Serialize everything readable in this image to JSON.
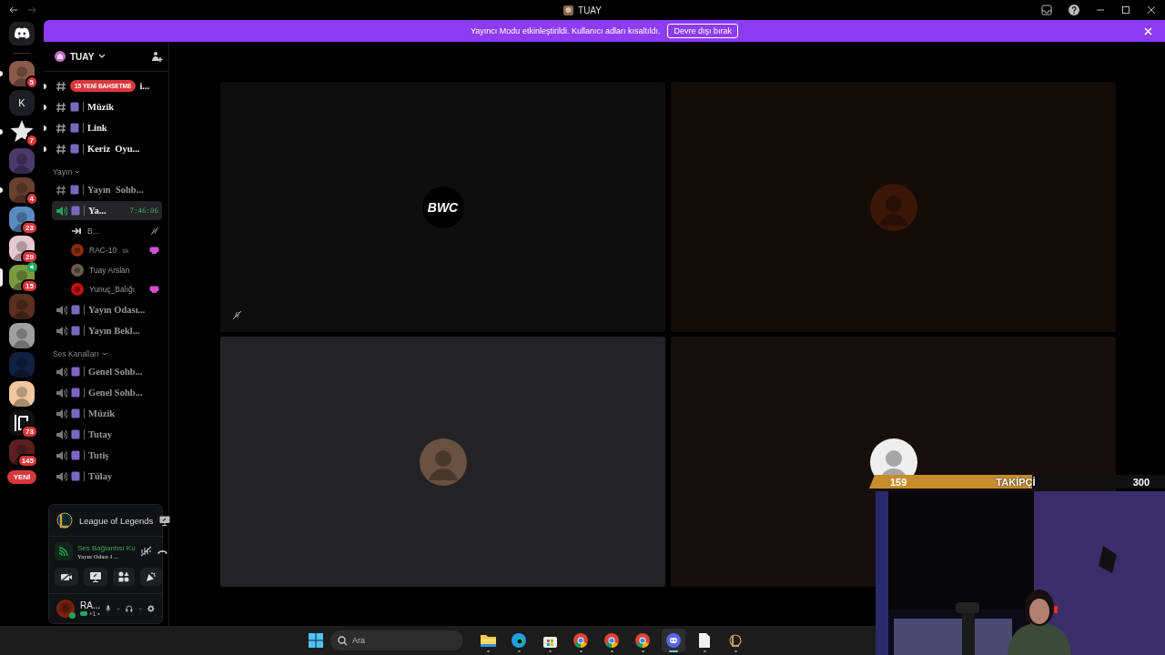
{
  "window": {
    "title": "TUAY"
  },
  "servers": [
    {
      "kind": "picture",
      "color": "#8a5a4a",
      "badge": "5",
      "unread": true,
      "selected": false,
      "voice": false
    },
    {
      "kind": "letter",
      "label": "K",
      "unread": false,
      "selected": false,
      "voice": false
    },
    {
      "kind": "star",
      "color": "#e8e8e8",
      "badge": "7",
      "unread": true,
      "selected": false,
      "voice": false
    },
    {
      "kind": "picture",
      "color": "#4a3a6a",
      "unread": false,
      "selected": false,
      "voice": false
    },
    {
      "kind": "picture",
      "color": "#6a4030",
      "badge": "4",
      "unread": true,
      "selected": false,
      "voice": false
    },
    {
      "kind": "picture",
      "color": "#5a8ac0",
      "badge": "23",
      "unread": false,
      "selected": false,
      "voice": false
    },
    {
      "kind": "picture",
      "color": "#e8c8d0",
      "badge": "29",
      "unread": false,
      "selected": false,
      "voice": false
    },
    {
      "kind": "picture",
      "color": "#7a9a40",
      "badge": "15",
      "unread": false,
      "selected": true,
      "voice": true
    },
    {
      "kind": "picture",
      "color": "#5a3020",
      "unread": false,
      "selected": false,
      "voice": false
    },
    {
      "kind": "picture",
      "color": "#a0a0a0",
      "unread": false,
      "selected": false,
      "voice": false
    },
    {
      "kind": "picture",
      "color": "#102040",
      "unread": false,
      "selected": false,
      "voice": false
    },
    {
      "kind": "picture",
      "color": "#f0c8a0",
      "unread": false,
      "selected": false,
      "voice": false
    },
    {
      "kind": "logo",
      "color": "#111111",
      "badge": "73",
      "unread": false,
      "selected": false,
      "voice": false
    },
    {
      "kind": "picture",
      "color": "#5a2020",
      "badge": "145",
      "unread": false,
      "selected": false,
      "voice": false
    }
  ],
  "new_button": "YENİ",
  "banner": {
    "text": "Yayıncı Modu etkinleştirildi. Kullanıcı adları kısaltıldı.",
    "button": "Devre dışı bırak"
  },
  "sidebar": {
    "server": "TUAY",
    "mention_pill": "15 YENİ BAHSETME",
    "channels": [
      {
        "kind": "text",
        "name": "i...",
        "mention": true,
        "unread": true,
        "selected": false
      },
      {
        "kind": "text",
        "name": "Müzik",
        "mention": false,
        "unread": true,
        "selected": false
      },
      {
        "kind": "text",
        "name": "Link",
        "mention": false,
        "unread": true,
        "selected": false
      },
      {
        "kind": "text",
        "name": "Keriz  Oyu...",
        "mention": false,
        "unread": true,
        "selected": false
      },
      {
        "kind": "category",
        "name": "Yayın"
      },
      {
        "kind": "text",
        "name": "Yayın  Sohb...",
        "mention": false,
        "unread": false,
        "selected": false
      },
      {
        "kind": "voice",
        "name": "Ya...",
        "time": "7:46:06",
        "unread": false,
        "selected": true,
        "children": [
          {
            "name": "B...",
            "kind": "icon",
            "muted": true,
            "streaming": false
          },
          {
            "name": "RAC-10",
            "kind": "avatar",
            "color": "#8a2a10",
            "status": "sk",
            "muted": false,
            "streaming": true
          },
          {
            "name": "Tuay Arslan",
            "kind": "avatar",
            "color": "#6a5a4a",
            "muted": false,
            "streaming": false
          },
          {
            "name": "Yunuç_Balığı",
            "kind": "avatar",
            "color": "#c01010",
            "muted": false,
            "streaming": true
          }
        ]
      },
      {
        "kind": "voice",
        "name": "Yayın Odası...",
        "unread": false,
        "selected": false
      },
      {
        "kind": "voice",
        "name": "Yayın Bekl...",
        "unread": false,
        "selected": false
      },
      {
        "kind": "category",
        "name": "Ses Kanalları"
      },
      {
        "kind": "voice",
        "name": "Genel Sohb...",
        "unread": false,
        "selected": false
      },
      {
        "kind": "voice",
        "name": "Genel Sohb...",
        "unread": false,
        "selected": false
      },
      {
        "kind": "voice",
        "name": "Müzik",
        "unread": false,
        "selected": false
      },
      {
        "kind": "voice",
        "name": "Tutay",
        "unread": false,
        "selected": false
      },
      {
        "kind": "voice",
        "name": "Tutiş",
        "unread": false,
        "selected": false
      },
      {
        "kind": "voice",
        "name": "Tülay",
        "unread": false,
        "selected": false
      }
    ]
  },
  "activity": {
    "game": "League of Legends"
  },
  "voice_connection": {
    "status": "Ses Bağlantısı Ku",
    "channel": "Yayın Odası 1 ..."
  },
  "user": {
    "name": "RA...",
    "status": "+1 •"
  },
  "tiles": [
    {
      "kind": "logo",
      "logo": "BWC",
      "color": "#0e0e0e",
      "muted": true
    },
    {
      "kind": "avatar",
      "color": "#130c07",
      "avatar": {
        "color": "#3a1606"
      },
      "muted": false
    },
    {
      "kind": "avatar",
      "color": "#232326",
      "avatar": {
        "color": "#6a5040"
      },
      "muted": false
    },
    {
      "kind": "avatar",
      "color": "#170e0e",
      "avatar": {
        "color": "#eeeeee"
      },
      "muted": false
    }
  ],
  "follower_goal": {
    "current": "159",
    "label": "TAKİPÇİ",
    "goal": "300",
    "level": 0.55
  },
  "taskbar": {
    "search_placeholder": "Ara",
    "apps": [
      {
        "kind": "files",
        "selected": false
      },
      {
        "kind": "edge",
        "selected": false
      },
      {
        "kind": "store",
        "selected": false
      },
      {
        "kind": "chrome",
        "selected": false
      },
      {
        "kind": "chrome",
        "selected": false
      },
      {
        "kind": "chrome",
        "selected": false
      },
      {
        "kind": "discord",
        "selected": true
      },
      {
        "kind": "file",
        "selected": false
      },
      {
        "kind": "league",
        "selected": false
      }
    ]
  }
}
